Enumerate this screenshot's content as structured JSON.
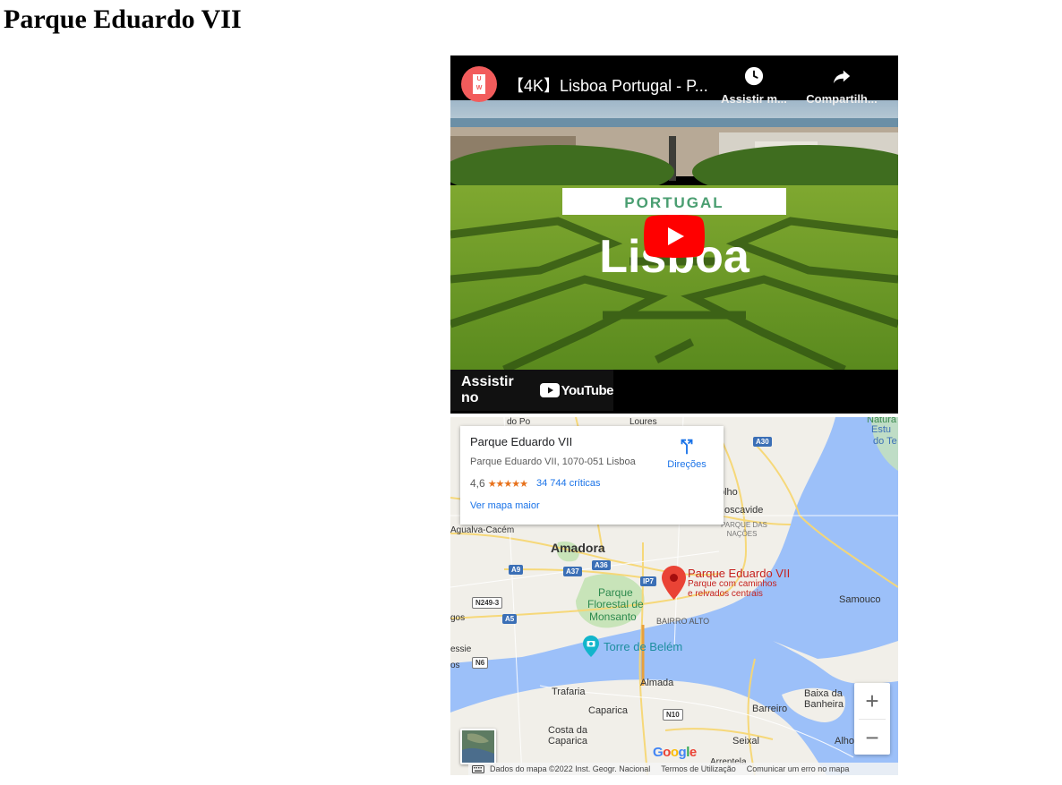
{
  "page": {
    "title": "Parque Eduardo VII"
  },
  "video": {
    "channel_badge": "U\nW",
    "title": "【4K】Lisboa Portugal - P...",
    "watch_later_label": "Assistir m...",
    "share_label": "Compartilh...",
    "thumb_banner": "PORTUGAL",
    "thumb_title": "Lisboa",
    "watch_on_label": "Assistir no",
    "youtube_word": "YouTube"
  },
  "map": {
    "card": {
      "name": "Parque Eduardo VII",
      "address": "Parque Eduardo VII, 1070-051 Lisboa",
      "rating": "4,6",
      "stars": "★★★★★",
      "reviews": "34 744 críticas",
      "bigger_map": "Ver mapa maior",
      "directions": "Direções"
    },
    "pin": {
      "title": "Parque Eduardo VII",
      "subtitle_1": "Parque com caminhos",
      "subtitle_2": "e relvados centrais"
    },
    "labels": {
      "amadora": "Amadora",
      "monsanto_1": "Parque",
      "monsanto_2": "Florestal de",
      "monsanto_3": "Monsanto",
      "torre": "Torre de Belém",
      "bairro": "BAIRRO ALTO",
      "almada": "Almada",
      "trafaria": "Trafaria",
      "caparica": "Caparica",
      "costa_1": "Costa da",
      "costa_2": "Caparica",
      "barreiro": "Barreiro",
      "baixa_1": "Baixa da",
      "baixa_2": "Banheira",
      "seixal": "Seixal",
      "samouco": "Samouco",
      "moscavide": "oscavide",
      "parque_nacoes_1": "PARQUE DAS",
      "parque_nacoes_2": "NAÇÕES",
      "agualva": "Agualva-Cacém",
      "loures": "Loures",
      "odo": "do Po",
      "olho": "olho",
      "natura_1": "Natura",
      "natura_2": "Estu",
      "natura_3": "do Te",
      "gos": "gos",
      "essie": "essie",
      "os": "os",
      "alho": "Alho",
      "arrentela": "Arrentela"
    },
    "shields": {
      "a30": "A30",
      "a9": "A9",
      "a37": "A37",
      "a36": "A36",
      "ip7": "IP7",
      "n249": "N249-3",
      "a5": "A5",
      "n6": "N6",
      "n10": "N10"
    },
    "zoom_in": "+",
    "zoom_out": "−",
    "google_logo": "Google",
    "footer": {
      "data": "Dados do mapa ©2022 Inst. Geogr. Nacional",
      "terms": "Termos de Utilização",
      "report": "Comunicar um erro no mapa"
    }
  }
}
